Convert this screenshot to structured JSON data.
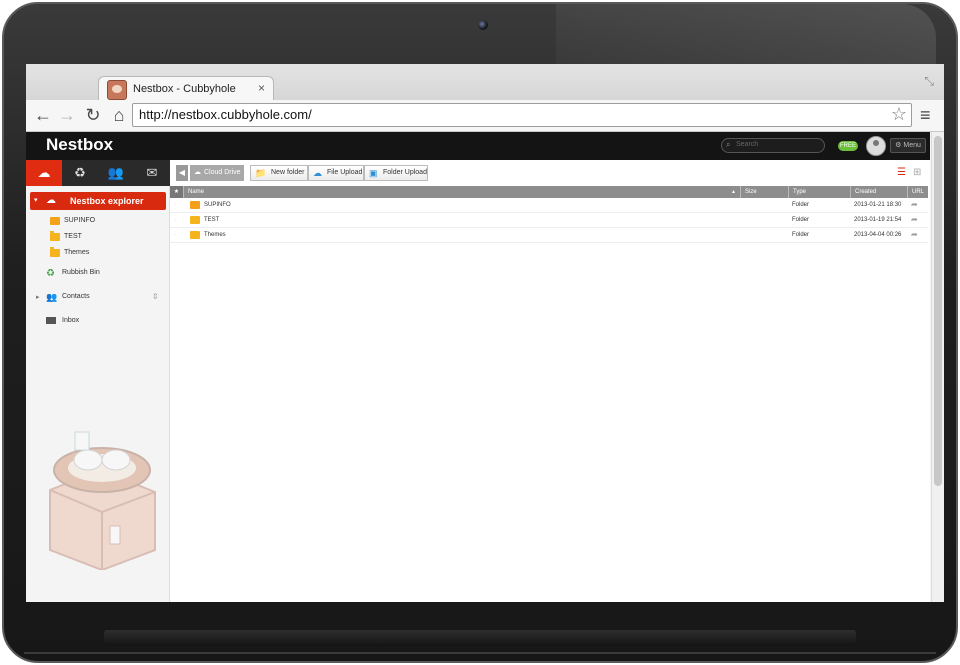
{
  "browser": {
    "tab_title": "Nestbox - Cubbyhole",
    "tab_close": "×",
    "url": "http://nestbox.cubbyhole.com/"
  },
  "app": {
    "brand": "Nestbox",
    "search_placeholder": "Search",
    "free_badge": "FREE",
    "menu_label": "Menu"
  },
  "sidebar": {
    "explorer_label": "Nestbox explorer",
    "folders": [
      {
        "label": "SUPINFO",
        "icon": "shared-folder-icon"
      },
      {
        "label": "TEST",
        "icon": "folder-icon"
      },
      {
        "label": "Themes",
        "icon": "folder-icon"
      }
    ],
    "rubbish_bin": "Rubbish Bin",
    "contacts": "Contacts",
    "inbox": "Inbox"
  },
  "toolbar": {
    "breadcrumb": "Cloud Drive",
    "new_folder": "New folder",
    "file_upload": "File Upload",
    "folder_upload": "Folder Upload"
  },
  "table": {
    "headers": {
      "name": "Name",
      "size": "Size",
      "type": "Type",
      "created": "Created",
      "url": "URL"
    },
    "rows": [
      {
        "name": "SUPINFO",
        "type": "Folder",
        "created": "2013-01-21 18:30",
        "icon": "shared-folder-icon"
      },
      {
        "name": "TEST",
        "type": "Folder",
        "created": "2013-01-19 21:54",
        "icon": "folder-icon"
      },
      {
        "name": "Themes",
        "type": "Folder",
        "created": "2013-04-04 00:26",
        "icon": "folder-icon"
      }
    ]
  },
  "colors": {
    "accent": "#d82a0f",
    "header": "#141414",
    "folder": "#f5b41b"
  }
}
